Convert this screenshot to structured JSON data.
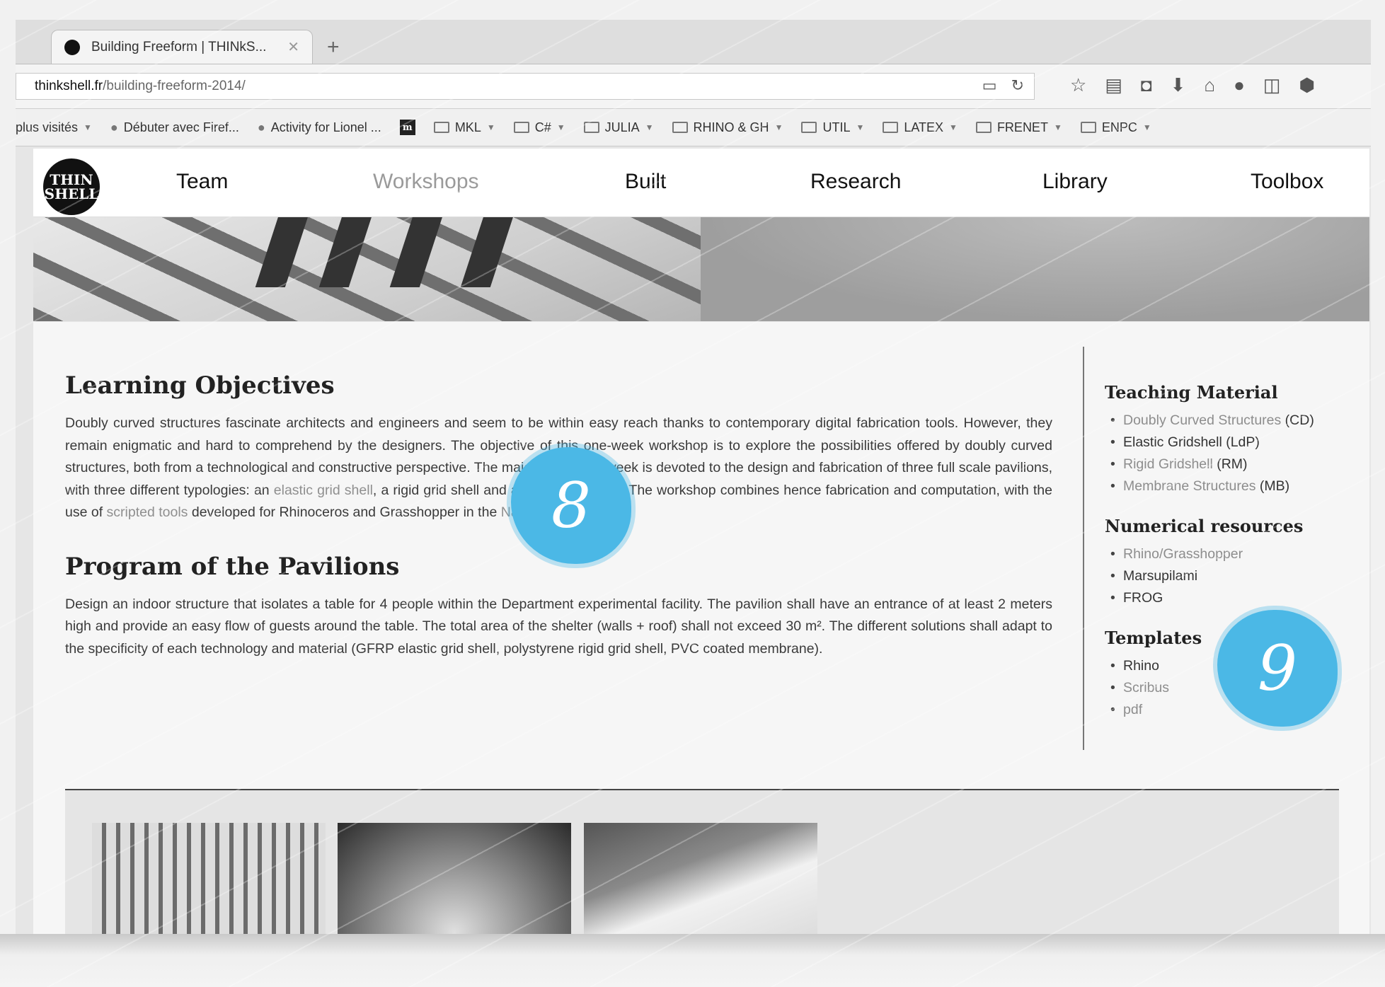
{
  "browser": {
    "tab_title": "Building Freeform | THINkS...",
    "tab_close": "✕",
    "new_tab": "+",
    "url_host": "thinkshell.fr",
    "url_path": "/building-freeform-2014/",
    "bookmarks": [
      {
        "label": "plus visités",
        "kind": "text",
        "caret": true
      },
      {
        "label": "Débuter avec Firef...",
        "kind": "icon"
      },
      {
        "label": "Activity for Lionel ...",
        "kind": "icon"
      },
      {
        "label": "m",
        "kind": "square"
      },
      {
        "label": "MKL",
        "kind": "folder",
        "caret": true
      },
      {
        "label": "C#",
        "kind": "folder",
        "caret": true
      },
      {
        "label": "JULIA",
        "kind": "folder",
        "caret": true
      },
      {
        "label": "RHINO & GH",
        "kind": "folder",
        "caret": true
      },
      {
        "label": "UTIL",
        "kind": "folder",
        "caret": true
      },
      {
        "label": "LATEX",
        "kind": "folder",
        "caret": true
      },
      {
        "label": "FRENET",
        "kind": "folder",
        "caret": true
      },
      {
        "label": "ENPC",
        "kind": "folder",
        "caret": true
      }
    ]
  },
  "site": {
    "logo_text": "THIN SHELL",
    "nav": [
      {
        "label": "Team",
        "active": false
      },
      {
        "label": "Workshops",
        "active": true
      },
      {
        "label": "Built",
        "active": false
      },
      {
        "label": "Research",
        "active": false
      },
      {
        "label": "Library",
        "active": false
      },
      {
        "label": "Toolbox",
        "active": false
      }
    ]
  },
  "main": {
    "h1": "Learning Objectives",
    "p1_a": "Doubly curved structures fascinate architects and engineers and seem to be within easy reach thanks to contemporary digital fabrication tools. However, they remain enigmatic and hard to comprehend by the designers. The objective of this one-week workshop is to explore the possibilities offered by doubly curved structures, both from a technological and constructive perspective. The major part of the week is devoted to the design and fabrication of three full scale pavilions, with three different typologies: an ",
    "p1_link1": "elastic grid shell",
    "p1_b": ", a rigid grid shell and a tensile structure. The workshop combines hence fabrication and computation, with the use of ",
    "p1_link2": "scripted tools",
    "p1_c": " developed for Rhinoceros and Grasshopper in the ",
    "p1_link3": "Navier Lab",
    "p1_d": ".",
    "h2": "Program of the Pavilions",
    "p2": "Design an indoor structure that isolates a table for 4 people within the Department experimental facility. The pavilion shall have an entrance of at least 2 meters high and provide an easy flow of guests around the table. The total area of the shelter (walls + roof) shall not exceed 30 m². The different solutions shall adapt to the specificity of each technology and material (GFRP elastic grid shell, polystyrene rigid grid shell, PVC coated membrane)."
  },
  "sidebar": {
    "teaching": {
      "title": "Teaching Material",
      "items": [
        {
          "link": "Doubly Curved Structures",
          "suffix": " (CD)"
        },
        {
          "link": "",
          "suffix": "Elastic Gridshell (LdP)"
        },
        {
          "link": "Rigid Gridshell",
          "suffix": " (RM)"
        },
        {
          "link": "Membrane Structures",
          "suffix": " (MB)"
        }
      ]
    },
    "numerical": {
      "title": "Numerical resources",
      "items": [
        {
          "link": "Rhino/Grasshopper",
          "suffix": ""
        },
        {
          "link": "",
          "suffix": "Marsupilami"
        },
        {
          "link": "",
          "suffix": "FROG"
        }
      ]
    },
    "templates": {
      "title": "Templates",
      "items": [
        {
          "link": "",
          "suffix": "Rhino"
        },
        {
          "link": "Scribus",
          "suffix": ""
        },
        {
          "link": "pdf",
          "suffix": ""
        }
      ]
    }
  },
  "badges": {
    "first": "8",
    "second": "9"
  },
  "colors": {
    "badge": "#4bb8e6"
  }
}
